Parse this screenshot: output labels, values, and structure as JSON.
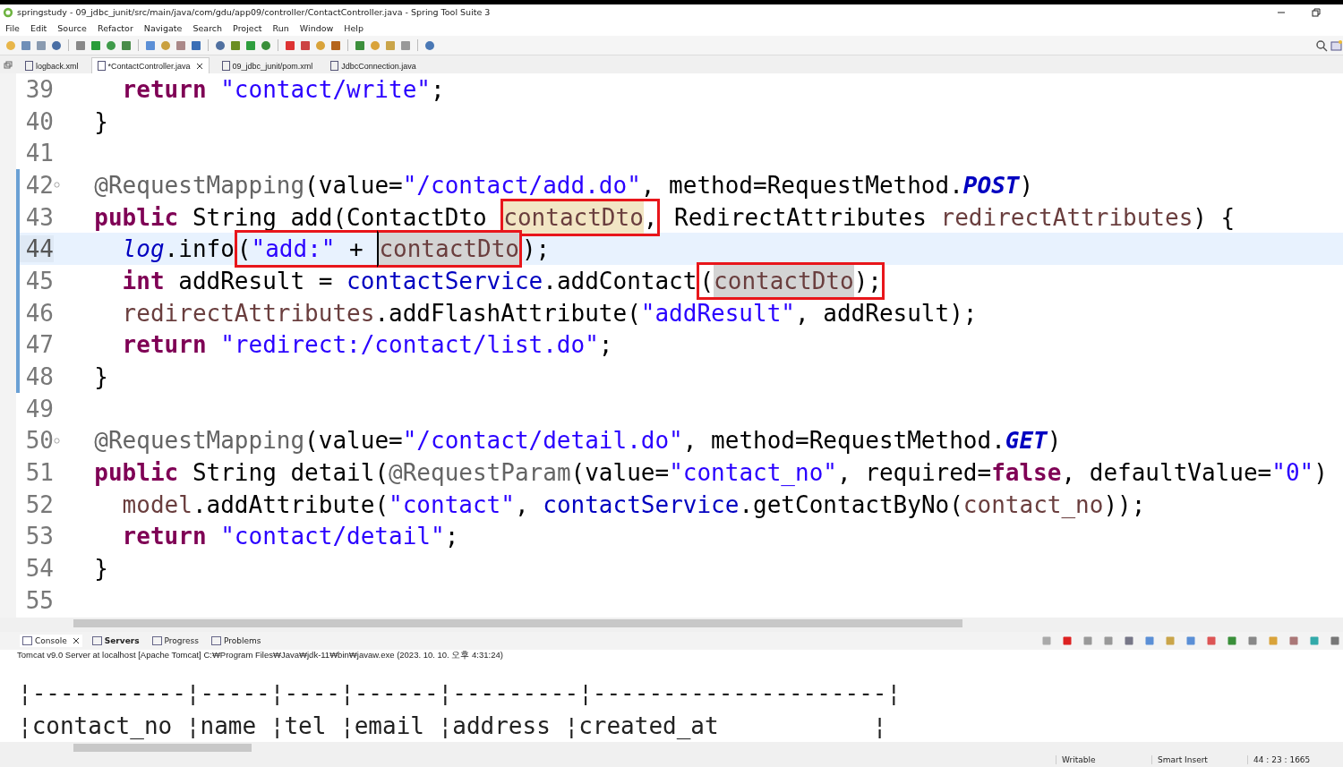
{
  "window": {
    "title": "springstudy - 09_jdbc_junit/src/main/java/com/gdu/app09/controller/ContactController.java - Spring Tool Suite 3"
  },
  "menu": [
    "File",
    "Edit",
    "Source",
    "Refactor",
    "Navigate",
    "Search",
    "Project",
    "Run",
    "Window",
    "Help"
  ],
  "editor_tabs": [
    {
      "label": "logback.xml",
      "selected": false,
      "closable": false
    },
    {
      "label": "*ContactController.java",
      "selected": true,
      "closable": true
    },
    {
      "label": "09_jdbc_junit/pom.xml",
      "selected": false,
      "closable": false
    },
    {
      "label": "JdbcConnection.java",
      "selected": false,
      "closable": false
    }
  ],
  "code": {
    "lines": [
      {
        "number": "39",
        "current": false,
        "fold": false,
        "changed": false,
        "tokens": [
          {
            "kind": "keyword",
            "text": "    return "
          },
          {
            "kind": "string",
            "text": "\"contact/write\""
          },
          {
            "kind": "plain",
            "text": ";"
          }
        ]
      },
      {
        "number": "40",
        "current": false,
        "fold": false,
        "changed": false,
        "tokens": [
          {
            "kind": "plain",
            "text": "  }"
          }
        ]
      },
      {
        "number": "41",
        "current": false,
        "fold": false,
        "changed": false
      },
      {
        "number": "42",
        "current": false,
        "fold": true,
        "changed": true,
        "tokens": [
          {
            "kind": "annotation",
            "text": "  @RequestMapping"
          },
          {
            "kind": "plain",
            "text": "(value="
          },
          {
            "kind": "string",
            "text": "\"/contact/add.do\""
          },
          {
            "kind": "plain",
            "text": ", method=RequestMethod."
          },
          {
            "kind": "constant",
            "text": "POST"
          },
          {
            "kind": "plain",
            "text": ")"
          }
        ]
      },
      {
        "number": "43",
        "current": false,
        "fold": false,
        "changed": true,
        "tokens": [
          {
            "kind": "keyword",
            "text": "  public"
          },
          {
            "kind": "plain",
            "text": " String add(ContactDto "
          },
          {
            "kind": "param",
            "text": "contactDto",
            "occurrence": true,
            "write": true,
            "boxed": true
          },
          {
            "kind": "plain",
            "text": ",",
            "boxed": true
          },
          {
            "kind": "plain",
            "text": " RedirectAttributes "
          },
          {
            "kind": "param",
            "text": "redirectAttributes"
          },
          {
            "kind": "plain",
            "text": ") {"
          }
        ]
      },
      {
        "number": "44",
        "current": true,
        "fold": false,
        "changed": true,
        "tokens": [
          {
            "kind": "static",
            "text": "    log"
          },
          {
            "kind": "plain",
            "text": ".info"
          },
          {
            "kind": "plain",
            "text": "(",
            "boxed": true
          },
          {
            "kind": "string",
            "text": "\"add:\"",
            "boxed": true
          },
          {
            "kind": "plain",
            "text": " + ",
            "boxed": true
          },
          {
            "kind": "param",
            "text": "contactDto",
            "occurrence": true,
            "write": false,
            "caret": true,
            "boxed": true
          },
          {
            "kind": "plain",
            "text": ");"
          }
        ]
      },
      {
        "number": "45",
        "current": false,
        "fold": false,
        "changed": true,
        "tokens": [
          {
            "kind": "keyword",
            "text": "    int"
          },
          {
            "kind": "plain",
            "text": " addResult = "
          },
          {
            "kind": "field",
            "text": "contactService"
          },
          {
            "kind": "plain",
            "text": ".addContact"
          },
          {
            "kind": "plain",
            "text": "(",
            "boxed": true
          },
          {
            "kind": "param",
            "text": "contactDto",
            "occurrence": true,
            "write": false,
            "boxed": true
          },
          {
            "kind": "plain",
            "text": ");",
            "boxed": true
          }
        ]
      },
      {
        "number": "46",
        "current": false,
        "fold": false,
        "changed": true,
        "tokens": [
          {
            "kind": "param",
            "text": "    redirectAttributes"
          },
          {
            "kind": "plain",
            "text": ".addFlashAttribute("
          },
          {
            "kind": "string",
            "text": "\"addResult\""
          },
          {
            "kind": "plain",
            "text": ", addResult);"
          }
        ]
      },
      {
        "number": "47",
        "current": false,
        "fold": false,
        "changed": true,
        "tokens": [
          {
            "kind": "keyword",
            "text": "    return "
          },
          {
            "kind": "string",
            "text": "\"redirect:/contact/list.do\""
          },
          {
            "kind": "plain",
            "text": ";"
          }
        ]
      },
      {
        "number": "48",
        "current": false,
        "fold": false,
        "changed": true,
        "tokens": [
          {
            "kind": "plain",
            "text": "  }"
          }
        ]
      },
      {
        "number": "49",
        "current": false,
        "fold": false,
        "changed": false
      },
      {
        "number": "50",
        "current": false,
        "fold": true,
        "changed": false,
        "tokens": [
          {
            "kind": "annotation",
            "text": "  @RequestMapping"
          },
          {
            "kind": "plain",
            "text": "(value="
          },
          {
            "kind": "string",
            "text": "\"/contact/detail.do\""
          },
          {
            "kind": "plain",
            "text": ", method=RequestMethod."
          },
          {
            "kind": "constant",
            "text": "GET"
          },
          {
            "kind": "plain",
            "text": ")"
          }
        ]
      },
      {
        "number": "51",
        "current": false,
        "fold": false,
        "changed": false,
        "tokens": [
          {
            "kind": "keyword",
            "text": "  public"
          },
          {
            "kind": "plain",
            "text": " String detail("
          },
          {
            "kind": "annotation",
            "text": "@RequestParam"
          },
          {
            "kind": "plain",
            "text": "(value="
          },
          {
            "kind": "string",
            "text": "\"contact_no\""
          },
          {
            "kind": "plain",
            "text": ", required="
          },
          {
            "kind": "keyword",
            "text": "false"
          },
          {
            "kind": "plain",
            "text": ", defaultValue="
          },
          {
            "kind": "string",
            "text": "\"0\""
          },
          {
            "kind": "plain",
            "text": ")"
          }
        ]
      },
      {
        "number": "52",
        "current": false,
        "fold": false,
        "changed": false,
        "tokens": [
          {
            "kind": "param",
            "text": "    model"
          },
          {
            "kind": "plain",
            "text": ".addAttribute("
          },
          {
            "kind": "string",
            "text": "\"contact\""
          },
          {
            "kind": "plain",
            "text": ", "
          },
          {
            "kind": "field",
            "text": "contactService"
          },
          {
            "kind": "plain",
            "text": ".getContactByNo("
          },
          {
            "kind": "param",
            "text": "contact_no"
          },
          {
            "kind": "plain",
            "text": "));"
          }
        ]
      },
      {
        "number": "53",
        "current": false,
        "fold": false,
        "changed": false,
        "tokens": [
          {
            "kind": "keyword",
            "text": "    return "
          },
          {
            "kind": "string",
            "text": "\"contact/detail\""
          },
          {
            "kind": "plain",
            "text": ";"
          }
        ]
      },
      {
        "number": "54",
        "current": false,
        "fold": false,
        "changed": false,
        "tokens": [
          {
            "kind": "plain",
            "text": "  }"
          }
        ]
      },
      {
        "number": "55",
        "current": false,
        "fold": false,
        "changed": false
      }
    ]
  },
  "console_tabs": [
    {
      "label": "Console",
      "selected": true,
      "closable": true,
      "bold": false
    },
    {
      "label": "Servers",
      "selected": false,
      "closable": false,
      "bold": true
    },
    {
      "label": "Progress",
      "selected": false,
      "closable": false,
      "bold": false
    },
    {
      "label": "Problems",
      "selected": false,
      "closable": false,
      "bold": false
    }
  ],
  "console": {
    "description": "Tomcat v9.0 Server at localhost [Apache Tomcat] C:₩Program Files₩Java₩jdk-11₩bin₩javaw.exe  (2023. 10. 10. 오후 4:31:24)",
    "lines": [
      "¦-----------¦-----¦----¦------¦---------¦---------------------¦",
      "¦contact_no ¦name ¦tel ¦email ¦address ¦created_at           ¦"
    ]
  },
  "status_bar": [
    "Writable",
    "Smart Insert",
    "44 : 23 : 1665"
  ]
}
